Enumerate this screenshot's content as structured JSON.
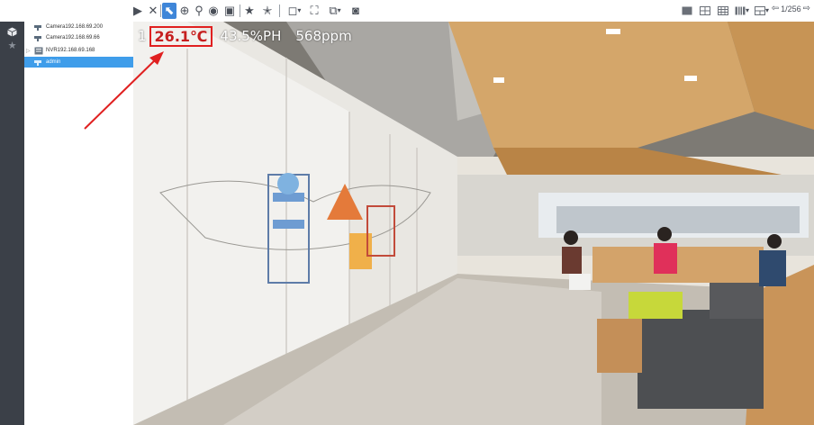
{
  "toolbar": {
    "items": [
      {
        "icon": "play-icon",
        "glyph": "▶"
      },
      {
        "icon": "close-icon",
        "glyph": "✕"
      },
      {
        "icon": "cursor-icon",
        "glyph": "⬉",
        "active": true
      },
      {
        "icon": "zoom-icon",
        "glyph": "⊕"
      },
      {
        "icon": "person-icon",
        "glyph": "⚲"
      },
      {
        "icon": "eye-icon",
        "glyph": "◉"
      },
      {
        "icon": "image-icon",
        "glyph": "▣"
      },
      {
        "icon": "star-icon",
        "glyph": "★"
      },
      {
        "icon": "star-add-icon",
        "glyph": "✭"
      },
      {
        "icon": "window-icon",
        "glyph": "◻"
      },
      {
        "icon": "fullscreen-icon",
        "glyph": "⛶"
      },
      {
        "icon": "record-icon",
        "glyph": "⧉"
      },
      {
        "icon": "camera-icon",
        "glyph": "◙"
      }
    ],
    "layout_icons": [
      "layout-1-icon",
      "layout-4-icon",
      "layout-9-icon",
      "layout-16-icon",
      "layout-custom-icon"
    ],
    "page_indicator": "1/256"
  },
  "tree": {
    "items": [
      {
        "label": "Camera192.168.69.200",
        "icon": "camera-icon",
        "selected": false
      },
      {
        "label": "Camera192.168.69.66",
        "icon": "camera-icon",
        "selected": false
      },
      {
        "label": "NVR192.168.69.168",
        "icon": "nvr-icon",
        "selected": false
      },
      {
        "label": "admin",
        "icon": "camera-icon",
        "selected": true
      }
    ]
  },
  "osd": {
    "channel": "1",
    "temperature": "26.1℃",
    "humidity": "43.5%PH",
    "co2": "568ppm"
  },
  "colors": {
    "accent": "#3f86d8",
    "selection": "#3f9dea",
    "highlight": "#e02020",
    "rail": "#3b4048"
  }
}
